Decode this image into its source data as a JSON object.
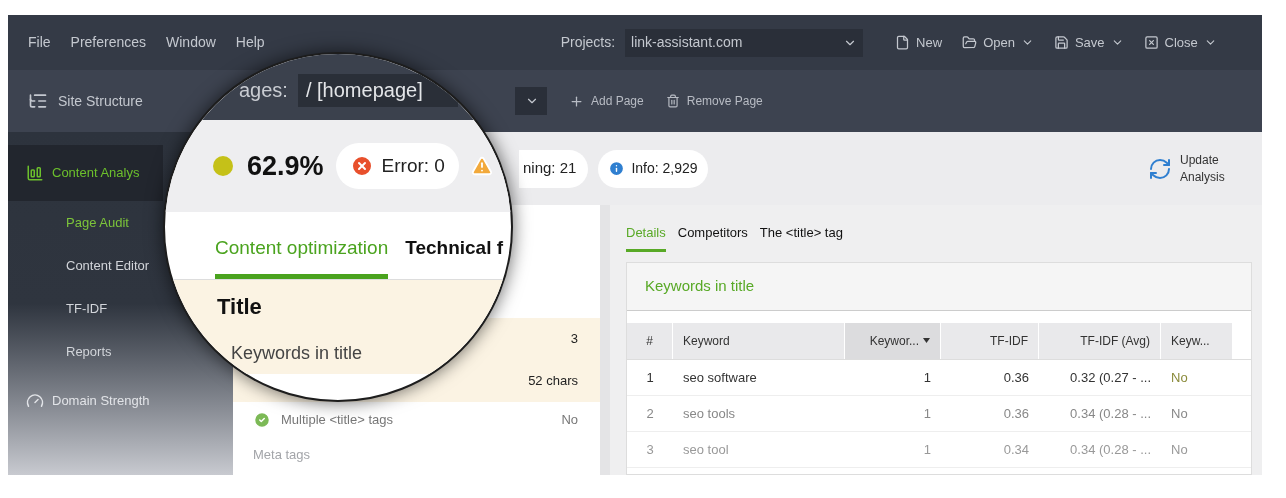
{
  "menu": [
    "File",
    "Preferences",
    "Window",
    "Help"
  ],
  "project": {
    "label": "Projects:",
    "value": "link-assistant.com"
  },
  "file_actions": [
    {
      "label": "New",
      "kind": "new",
      "dropdown": false
    },
    {
      "label": "Open",
      "kind": "open",
      "dropdown": true
    },
    {
      "label": "Save",
      "kind": "save",
      "dropdown": true
    },
    {
      "label": "Close",
      "kind": "close",
      "dropdown": true
    }
  ],
  "sidebar": {
    "header": {
      "label": "Site Structure"
    },
    "items": [
      {
        "label": "Content Analys",
        "kind": "chart",
        "selected": true,
        "children": [
          {
            "label": "Page Audit",
            "selected": true
          },
          {
            "label": "Content Editor",
            "selected": false
          },
          {
            "label": "TF-IDF",
            "selected": false
          },
          {
            "label": "Reports",
            "selected": false
          }
        ]
      },
      {
        "label": "Domain Strength",
        "kind": "gauge",
        "selected": false
      }
    ]
  },
  "page_toolbar": {
    "pages_label": "ages:",
    "page_value": "/ [homepage]",
    "buttons": [
      {
        "label": "Add Page",
        "kind": "add"
      },
      {
        "label": "Remove Page",
        "kind": "remove"
      }
    ]
  },
  "score": {
    "value": "62.9%",
    "color": "#c5c118"
  },
  "badges": [
    {
      "kind": "error",
      "text": "Error: 0"
    },
    {
      "kind": "warning",
      "text": "ning: 21"
    },
    {
      "kind": "info",
      "text": "Info: 2,929"
    }
  ],
  "update_button": "Update Analysis",
  "audit_tabs": [
    {
      "label": "Content optimization",
      "selected": true
    },
    {
      "label": "Technical f",
      "selected": false
    }
  ],
  "audit_rows": [
    {
      "kind": "section",
      "label": "Title",
      "value": "3",
      "highlighted": true
    },
    {
      "kind": "factor",
      "label": "Keywords in title",
      "value": "52 chars",
      "highlighted": true
    },
    {
      "kind": "check",
      "label": "Multiple <title> tags",
      "value": "No",
      "highlighted": false
    },
    {
      "kind": "section",
      "label": "Meta tags",
      "highlighted": false
    }
  ],
  "details_tabs": [
    {
      "label": "Details",
      "selected": true
    },
    {
      "label": "Competitors",
      "selected": false
    },
    {
      "label": "The <title> tag",
      "selected": false
    }
  ],
  "details_card": {
    "title": "Keywords in title",
    "columns": [
      {
        "label": "#",
        "sorted": false
      },
      {
        "label": "Keyword",
        "sorted": false
      },
      {
        "label": "Keywor...",
        "sorted": true
      },
      {
        "label": "TF-IDF",
        "sorted": false
      },
      {
        "label": "TF-IDF (Avg)",
        "sorted": false
      },
      {
        "label": "Keyw...",
        "sorted": false
      }
    ],
    "rows": [
      [
        "1",
        "seo software",
        "1",
        "0.36",
        "0.32 (0.27 - ...",
        "No"
      ],
      [
        "2",
        "seo tools",
        "1",
        "0.36",
        "0.34 (0.28 - ...",
        "No"
      ],
      [
        "3",
        "seo tool",
        "1",
        "0.34",
        "0.34 (0.28 - ...",
        "No"
      ]
    ]
  }
}
